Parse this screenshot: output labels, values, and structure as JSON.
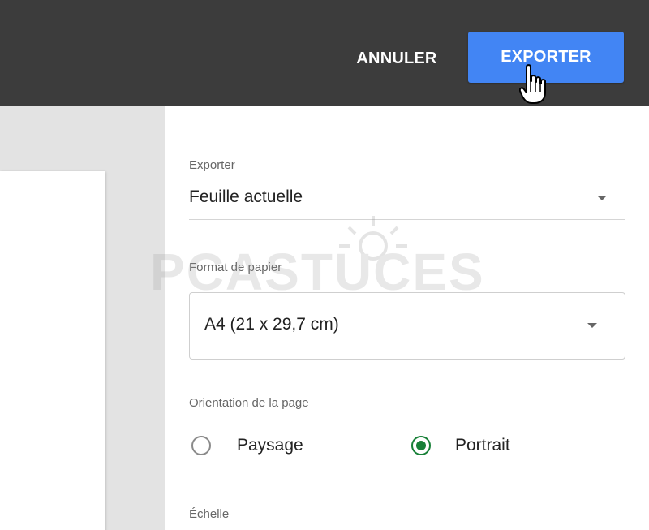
{
  "header": {
    "cancel_label": "ANNULER",
    "export_label": "EXPORTER",
    "background_color": "#3c3c3c",
    "accent_color": "#4285f4"
  },
  "settings": {
    "export": {
      "label": "Exporter",
      "value": "Feuille actuelle"
    },
    "paper_format": {
      "label": "Format de papier",
      "value": "A4 (21 x 29,7 cm)"
    },
    "orientation": {
      "label": "Orientation de la page",
      "options": [
        {
          "label": "Paysage",
          "selected": false
        },
        {
          "label": "Portrait",
          "selected": true
        }
      ],
      "selected_color": "#188038"
    },
    "scale": {
      "label": "Échelle"
    }
  },
  "watermark": {
    "text": "PCASTUCES"
  },
  "icons": {
    "cursor": "hand-pointer-icon",
    "dropdown": "caret-down-icon"
  }
}
